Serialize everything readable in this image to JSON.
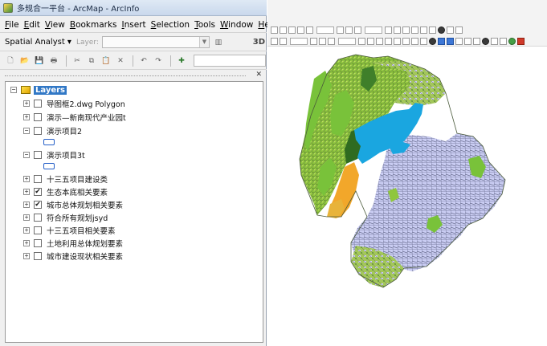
{
  "window": {
    "title": "多规合一平台 - ArcMap - ArcInfo"
  },
  "menu": {
    "items": [
      "File",
      "Edit",
      "View",
      "Bookmarks",
      "Insert",
      "Selection",
      "Tools",
      "Window",
      "Help"
    ]
  },
  "spatial_analyst_toolbar": {
    "button_label": "Spatial Analyst ▾",
    "layer_label": "Layer:",
    "layer_value": "",
    "three_d_label": "3D"
  },
  "toc": {
    "root_label": "Layers",
    "layers": [
      {
        "label": "导图框2.dwg Polygon",
        "checked": false,
        "expanded": false
      },
      {
        "label": "演示—新南现代产业园t",
        "checked": false,
        "expanded": false
      },
      {
        "label": "演示项目2",
        "checked": false,
        "expanded": true
      },
      {
        "label": "演示项目3t",
        "checked": false,
        "expanded": true
      },
      {
        "label": "十三五项目建设类",
        "checked": false,
        "expanded": false
      },
      {
        "label": "生态本底相关要素",
        "checked": true,
        "expanded": false
      },
      {
        "label": "城市总体规划相关要素",
        "checked": true,
        "expanded": false
      },
      {
        "label": "符合所有规划jsyd",
        "checked": false,
        "expanded": false
      },
      {
        "label": "十三五项目相关要素",
        "checked": false,
        "expanded": false
      },
      {
        "label": "土地利用总体规划要素",
        "checked": false,
        "expanded": false
      },
      {
        "label": "城市建设现状相关要素",
        "checked": false,
        "expanded": false
      }
    ]
  },
  "icons": {
    "new": "new-document-icon",
    "open": "open-folder-icon",
    "save": "save-icon",
    "cut": "cut-icon",
    "copy": "copy-icon",
    "paste": "paste-icon",
    "delete": "delete-icon",
    "undo": "undo-icon",
    "redo": "redo-icon",
    "add_data": "add-data-icon"
  },
  "colors": {
    "water": "#1aa6e0",
    "urban": "#c9ccf2",
    "urban_lines": "#6a6e90",
    "forest_dark": "#2f6b20",
    "forest_light": "#79c23a",
    "farmland": "#a7d54a",
    "orange": "#f2a72a",
    "selection_blue": "#3178c6"
  }
}
